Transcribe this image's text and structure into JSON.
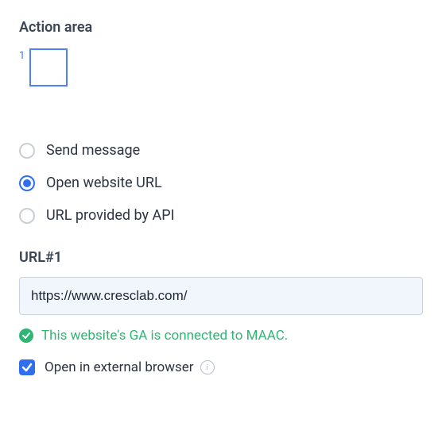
{
  "section_title": "Action area",
  "preview": {
    "index": "1"
  },
  "action_type": {
    "options": [
      {
        "label": "Send message",
        "selected": false
      },
      {
        "label": "Open website URL",
        "selected": true
      },
      {
        "label": "URL provided by API",
        "selected": false
      }
    ]
  },
  "url_field": {
    "label": "URL#1",
    "value": "https://www.cresclab.com/"
  },
  "status": {
    "text": "This website's GA is connected to MAAC.",
    "ok": true
  },
  "open_external": {
    "label": "Open in external browser",
    "checked": true
  }
}
